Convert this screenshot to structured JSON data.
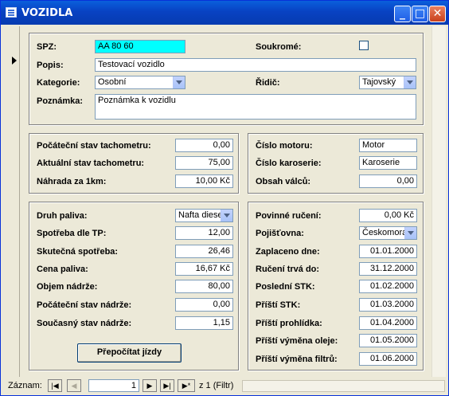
{
  "window": {
    "title": "VOZIDLA",
    "min": "_",
    "max": "□",
    "close": "✕"
  },
  "top": {
    "spz_label": "SPZ:",
    "spz_value": "AA 80 60",
    "soukrome_label": "Soukromé:",
    "popis_label": "Popis:",
    "popis_value": "Testovací vozidlo",
    "kategorie_label": "Kategorie:",
    "kategorie_value": "Osobní",
    "ridic_label": "Řidič:",
    "ridic_value": "Tajovský",
    "poznamka_label": "Poznámka:",
    "poznamka_value": "Poznámka k vozidlu"
  },
  "tacho": {
    "pocatecni_label": "Počáteční stav tachometru:",
    "pocatecni_value": "0,00",
    "aktualni_label": "Aktuální stav tachometru:",
    "aktualni_value": "75,00",
    "nahrada_label": "Náhrada za 1km:",
    "nahrada_value": "10,00 Kč"
  },
  "motor": {
    "cislo_motoru_label": "Číslo motoru:",
    "cislo_motoru_value": "Motor",
    "cislo_karoserie_label": "Číslo karoserie:",
    "cislo_karoserie_value": "Karoserie",
    "obsah_label": "Obsah válců:",
    "obsah_value": "0,00"
  },
  "fuel": {
    "druh_label": "Druh paliva:",
    "druh_value": "Nafta diesel",
    "spotreba_tp_label": "Spotřeba dle TP:",
    "spotreba_tp_value": "12,00",
    "skutecna_label": "Skutečná spotřeba:",
    "skutecna_value": "26,46",
    "cena_label": "Cena paliva:",
    "cena_value": "16,67 Kč",
    "objem_label": "Objem nádrže:",
    "objem_value": "80,00",
    "pocatecni_nadrz_label": "Počáteční stav nádrže:",
    "pocatecni_nadrz_value": "0,00",
    "soucasny_label": "Současný stav nádrže:",
    "soucasny_value": "1,15",
    "recalc_button": "Přepočítat jízdy"
  },
  "insurance": {
    "povinne_label": "Povinné ručení:",
    "povinne_value": "0,00 Kč",
    "pojistovna_label": "Pojišťovna:",
    "pojistovna_value": "Českomoravská",
    "zaplaceno_label": "Zaplaceno dne:",
    "zaplaceno_value": "01.01.2000",
    "ruceni_label": "Ručení trvá do:",
    "ruceni_value": "31.12.2000",
    "posledni_stk_label": "Poslední STK:",
    "posledni_stk_value": "01.02.2000",
    "pristi_stk_label": "Příští STK:",
    "pristi_stk_value": "01.03.2000",
    "prohlidka_label": "Příští prohlídka:",
    "prohlidka_value": "01.04.2000",
    "olej_label": "Příští výměna oleje:",
    "olej_value": "01.05.2000",
    "filtr_label": "Příští výměna filtrů:",
    "filtr_value": "01.06.2000"
  },
  "status": {
    "zaznam_label": "Záznam:",
    "first": "|◀",
    "prev": "◀",
    "current": "1",
    "next": "▶",
    "last": "▶|",
    "new": "▶*",
    "total": "z  1 (Filtr)"
  }
}
